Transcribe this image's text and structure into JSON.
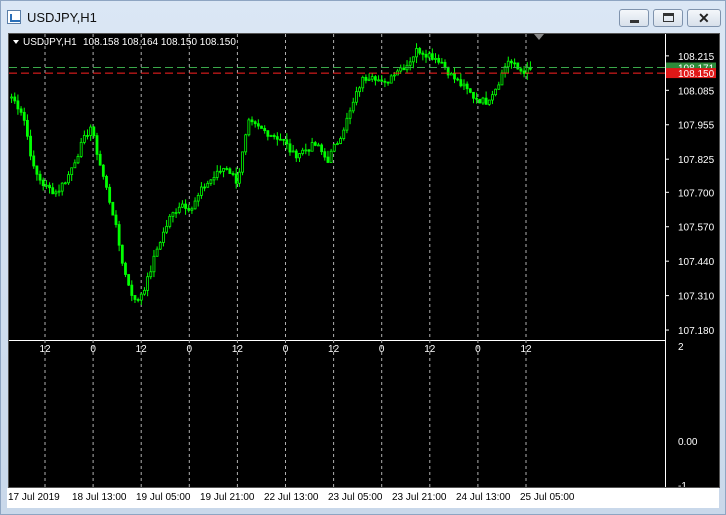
{
  "window": {
    "title": "USDJPY,H1"
  },
  "chart_info": {
    "symbol_tf": "USDJPY,H1",
    "ohlc": "108.158 108.164 108.150 108.150"
  },
  "price_axis": {
    "ticks": [
      "108.215",
      "108.085",
      "107.955",
      "107.825",
      "107.700",
      "107.570",
      "107.440",
      "107.310",
      "107.180"
    ],
    "ask_tag": "108.171",
    "bid_tag": "108.150"
  },
  "indicator_axis": {
    "ticks": [
      "2",
      "0.00",
      "-1"
    ]
  },
  "hour_labels": [
    "12",
    "0",
    "12",
    "0",
    "12",
    "0",
    "12",
    "0",
    "12",
    "0",
    "12"
  ],
  "time_axis": [
    "17 Jul 2019",
    "18 Jul 13:00",
    "19 Jul 05:00",
    "19 Jul 21:00",
    "22 Jul 13:00",
    "23 Jul 05:00",
    "23 Jul 21:00",
    "24 Jul 13:00",
    "25 Jul 05:00"
  ],
  "colors": {
    "candle": "#00ff00",
    "ask_line": "#3aa84a",
    "bid_line": "#ff2222",
    "bid_tag_bg": "#e01818",
    "ask_tag_bg": "#2e8b3a"
  },
  "chart_data": {
    "type": "line",
    "title": "USDJPY,H1",
    "x": [
      "17 Jul 2019",
      "18 Jul 13:00",
      "19 Jul 05:00",
      "19 Jul 21:00",
      "22 Jul 13:00",
      "23 Jul 05:00",
      "23 Jul 21:00",
      "24 Jul 13:00",
      "25 Jul 05:00"
    ],
    "series": [
      {
        "values": [
          108.08,
          107.73,
          107.28,
          107.74,
          107.92,
          108.14,
          108.23,
          108.05,
          108.16
        ]
      }
    ],
    "ylim": [
      107.15,
      108.29
    ],
    "grid": true,
    "legend": "none"
  }
}
